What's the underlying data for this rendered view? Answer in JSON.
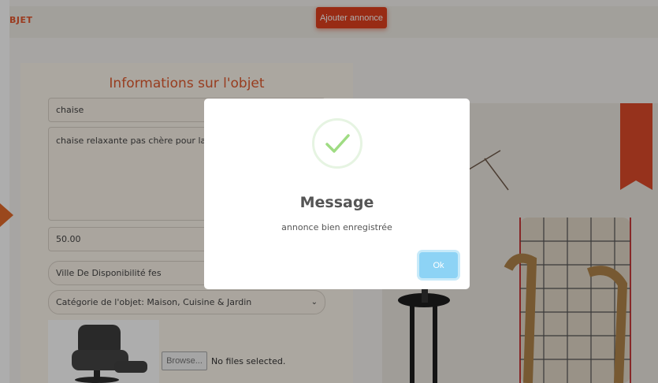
{
  "header": {
    "brand": "BJET",
    "add_button_label": "Ajouter annonce"
  },
  "form": {
    "title": "Informations sur l'objet",
    "name_value": "chaise",
    "description_value": "chaise relaxante pas chère pour la",
    "price_value": "50.00",
    "city_value": "Ville De Disponibilité fes",
    "category_value": "Catégorie de l'objet: Maison, Cuisine & Jardin",
    "browse_label": "Browse...",
    "file_status": "No files selected."
  },
  "modal": {
    "title": "Message",
    "text": "annonce bien enregistrée",
    "ok_label": "Ok"
  },
  "colors": {
    "accent": "#e0401e",
    "title": "#e05a2f",
    "success": "#9fdc83",
    "ok_button": "#8dd3f5"
  }
}
